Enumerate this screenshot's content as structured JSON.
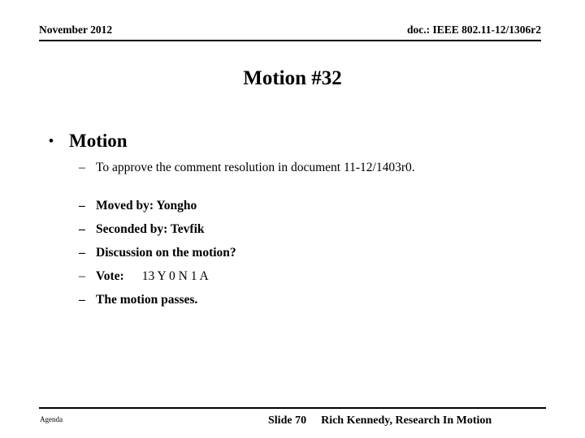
{
  "header": {
    "date": "November 2012",
    "doc": "doc.: IEEE 802.11-12/1306r2"
  },
  "title": "Motion #32",
  "content": {
    "bullet_marker": "•",
    "dash_marker": "–",
    "level1": "Motion",
    "sub_bullets": [
      "To approve the comment resolution in document 11-12/1403r0.",
      "Moved by: Yongho",
      "Seconded by: Tevfik",
      "Discussion on the motion?",
      "The motion passes."
    ],
    "vote": {
      "label": "Vote:",
      "tally": "13 Y  0 N  1 A"
    }
  },
  "footer": {
    "agenda": "Agenda",
    "slide": "Slide 70",
    "author": "Rich Kennedy, Research In Motion"
  },
  "colors": {
    "text": "#000000",
    "background": "#ffffff",
    "rule": "#000000"
  }
}
